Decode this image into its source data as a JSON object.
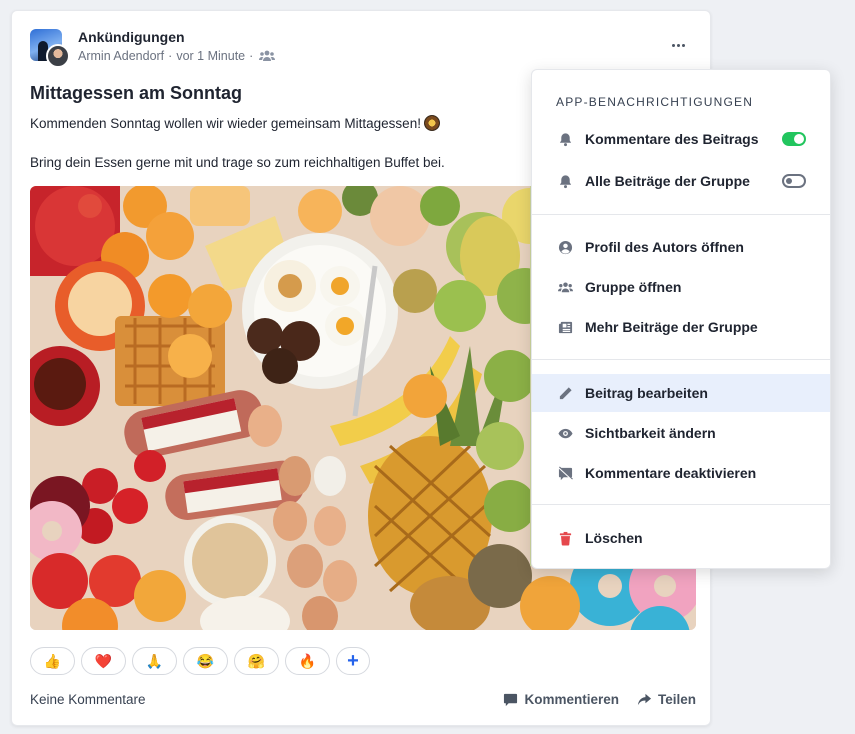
{
  "post": {
    "group_name": "Ankündigungen",
    "author": "Armin Adendorf",
    "separator": "·",
    "time": "vor 1 Minute",
    "title": "Mittagessen am Sonntag",
    "paragraph1": "Kommenden Sonntag wollen wir wieder gemeinsam Mittagessen!",
    "paragraph2": "Bring dein Essen gerne mit und trage so zum reichhaltigen Buffet bei."
  },
  "reactions": [
    {
      "emoji": "👍",
      "icon": "thumbs-up-icon"
    },
    {
      "emoji": "❤️",
      "icon": "heart-icon"
    },
    {
      "emoji": "🙏",
      "icon": "folded-hands-icon"
    },
    {
      "emoji": "😂",
      "icon": "laughing-icon"
    },
    {
      "emoji": "🤗",
      "icon": "hugging-icon"
    },
    {
      "emoji": "🔥",
      "icon": "fire-icon"
    },
    {
      "emoji": "+",
      "icon": "add-reaction-icon"
    }
  ],
  "footer": {
    "no_comments": "Keine Kommentare",
    "comment": "Kommentieren",
    "share": "Teilen"
  },
  "menu": {
    "section_title": "APP-BENACHRICHTIGUNGEN",
    "notify_comments": "Kommentare des Beitrags",
    "notify_comments_on": true,
    "notify_group": "Alle Beiträge der Gruppe",
    "notify_group_on": false,
    "open_profile": "Profil des Autors öffnen",
    "open_group": "Gruppe öffnen",
    "more_posts": "Mehr Beiträge der Gruppe",
    "edit_post": "Beitrag bearbeiten",
    "change_visibility": "Sichtbarkeit ändern",
    "disable_comments": "Kommentare deaktivieren",
    "delete": "Löschen"
  },
  "colors": {
    "toggle_on": "#22c55e",
    "highlight": "#e8effc",
    "delete_icon": "#e5484d",
    "add_reaction": "#2563eb"
  }
}
